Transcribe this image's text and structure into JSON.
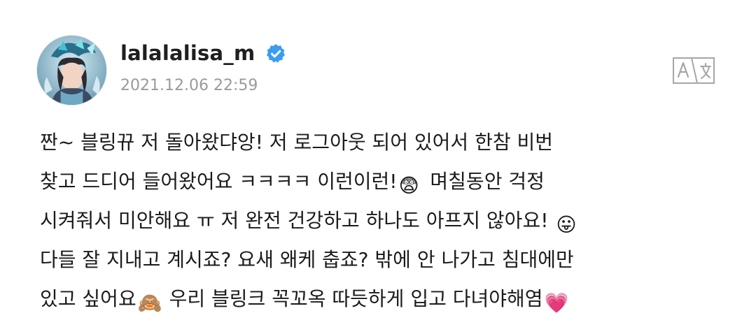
{
  "post": {
    "username": "lalalalisa_m",
    "timestamp": "2021.12.06 22:59",
    "verified": true,
    "accent_color": "#3b9cf2",
    "icons": {
      "verified": "verified-badge-icon",
      "translate": "translate-icon"
    },
    "body": {
      "line1": "짠~ 블링뀨 저 돌아왔댜앙! 저 로그아웃 되어 있어서 한참 비번",
      "line2": "찾고 드디어 들어왔어요 ㅋㅋㅋㅋ 이런이런!",
      "line2_emoji": "😨",
      "line2_rest": " 며칠동안 걱정",
      "line3": "시켜줘서 미안해요 ㅠ 저 완전 건강하고 하나도 아프지 않아요! ",
      "line3_emoji": "😛",
      "line4": "다들 잘 지내고 계시죠? 요새 왜케 춥죠? 밖에 안 나가고 침대에만",
      "line5": "있고 싶어요",
      "line5_emoji": "🙈",
      "line5_rest": " 우리 블링크 꼭꼬옥 따듯하게 입고 다녀야해염",
      "line5_emoji2": "💗"
    }
  }
}
